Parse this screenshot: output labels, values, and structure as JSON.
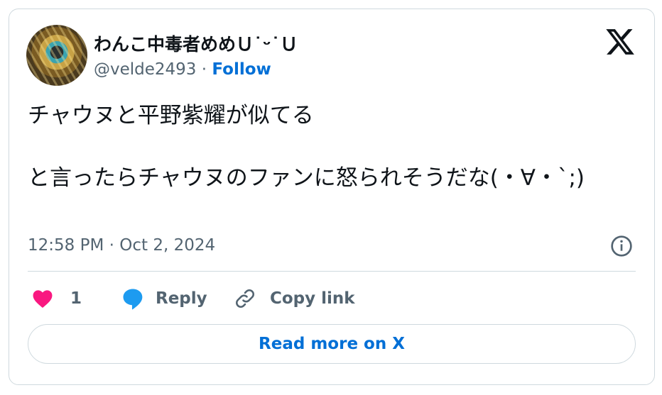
{
  "author": {
    "display_name": "わんこ中毒者めめＵ˙ᵕ˙Ｕ",
    "handle": "@velde2493",
    "separator": "·",
    "follow_label": "Follow"
  },
  "tweet": {
    "text": "チャウヌと平野紫耀が似てる\n\nと言ったらチャウヌのファンに怒られそうだな(・∀・`;)",
    "timestamp": "12:58 PM · Oct 2, 2024"
  },
  "actions": {
    "like_count": "1",
    "reply_label": "Reply",
    "copy_link_label": "Copy link"
  },
  "read_more_label": "Read more on X",
  "colors": {
    "accent": "#006fd6",
    "like": "#f91880",
    "reply": "#1d9bf0",
    "muted": "#536471",
    "border": "#cfd9de"
  },
  "icons": {
    "logo": "x-logo-icon",
    "info": "info-icon",
    "like": "heart-icon",
    "reply": "speech-bubble-icon",
    "copy_link": "link-icon"
  }
}
